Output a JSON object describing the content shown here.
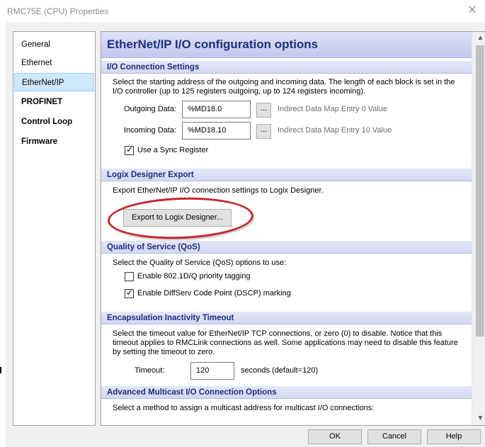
{
  "window": {
    "title": "RMC75E (CPU) Properties",
    "close_glyph": "✕"
  },
  "sidebar": {
    "items": [
      {
        "label": "General"
      },
      {
        "label": "Ethernet"
      },
      {
        "label": "EtherNet/IP"
      },
      {
        "label": "PROFINET"
      },
      {
        "label": "Control Loop"
      },
      {
        "label": "Firmware"
      }
    ],
    "selected": "EtherNet/IP"
  },
  "content": {
    "title": "EtherNet/IP I/O configuration options",
    "io_section": {
      "heading": "I/O Connection Settings",
      "description": "Select the starting address of the outgoing and incoming data. The length of each block is set in the I/O controller (up to 125 registers outgoing, up to 124 registers incoming).",
      "outgoing_label": "Outgoing Data:",
      "outgoing_value": "%MD18.0",
      "outgoing_hint": "Indirect Data Map Entry 0 Value",
      "incoming_label": "Incoming Data:",
      "incoming_value": "%MD18.10",
      "incoming_hint": "Indirect Data Map Entry 10 Value",
      "browse_label": "...",
      "sync_register_label": "Use a Sync Register",
      "sync_register_checked": true
    },
    "logix_section": {
      "heading": "Logix Designer Export",
      "description": "Export EtherNet/IP I/O connection settings to Logix Designer.",
      "export_button": "Export to Logix Designer..."
    },
    "qos_section": {
      "heading": "Quality of Service (QoS)",
      "description": "Select the Quality of Service (QoS) options to use:",
      "option_8021dq_label": "Enable 802.1D/Q priority tagging",
      "option_8021dq_checked": false,
      "option_dscp_label": "Enable DiffServ Code Point (DSCP) marking",
      "option_dscp_checked": true
    },
    "timeout_section": {
      "heading": "Encapsulation Inactivity Timeout",
      "description": "Select the timeout value for EtherNet/IP TCP connections, or zero (0) to disable. Notice that this timeout applies to RMCLink connections as well. Some applications may need to disable this feature by setting the timeout to zero.",
      "timeout_label": "Timeout:",
      "timeout_value": "120",
      "timeout_suffix": "seconds (default=120)"
    },
    "multicast_section": {
      "heading": "Advanced Multicast I/O Connection Options",
      "description": "Select a method to assign a multicast address for multicast I/O connections:"
    }
  },
  "footer": {
    "ok": "OK",
    "cancel": "Cancel",
    "help": "Help"
  },
  "colors": {
    "header_text": "#1c2f82",
    "header_bg_top": "#dfe1f8",
    "header_bg_bottom": "#c3c6ee",
    "selected_nav_bg": "#cde8ff",
    "highlight_circle": "#c8262b"
  }
}
